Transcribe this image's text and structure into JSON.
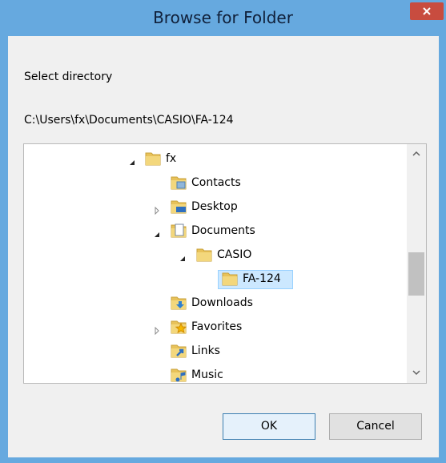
{
  "window": {
    "title": "Browse for Folder",
    "close_glyph": "✕"
  },
  "dialog": {
    "instruction": "Select directory",
    "current_path": "C:\\Users\\fx\\Documents\\CASIO\\FA-124"
  },
  "tree": {
    "items": [
      {
        "label": "fx",
        "expander": "expanded",
        "icon": "folder-icon"
      },
      {
        "label": "Contacts",
        "expander": "none",
        "icon": "contacts-folder-icon"
      },
      {
        "label": "Desktop",
        "expander": "collapsed",
        "icon": "desktop-folder-icon"
      },
      {
        "label": "Documents",
        "expander": "expanded",
        "icon": "documents-folder-icon"
      },
      {
        "label": "CASIO",
        "expander": "expanded",
        "icon": "folder-icon"
      },
      {
        "label": "FA-124",
        "expander": "none",
        "icon": "folder-icon",
        "selected": true
      },
      {
        "label": "Downloads",
        "expander": "none",
        "icon": "downloads-folder-icon"
      },
      {
        "label": "Favorites",
        "expander": "collapsed",
        "icon": "favorites-folder-icon"
      },
      {
        "label": "Links",
        "expander": "none",
        "icon": "links-folder-icon"
      },
      {
        "label": "Music",
        "expander": "none",
        "icon": "music-folder-icon"
      }
    ]
  },
  "buttons": {
    "ok_label": "OK",
    "cancel_label": "Cancel"
  },
  "colors": {
    "titlebar": "#66a9df",
    "close_button": "#c84c3f",
    "selection_fill": "#cce8ff",
    "selection_border": "#99d1ff",
    "folder_yellow": "#e8c25a"
  }
}
